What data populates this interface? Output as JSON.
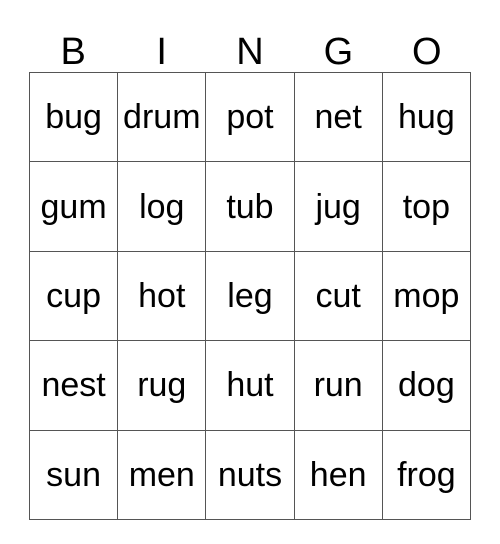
{
  "card": {
    "title": "BINGO",
    "header_letters": [
      "B",
      "I",
      "N",
      "G",
      "O"
    ],
    "colors": {
      "background": "#ffffff",
      "text": "#000000",
      "grid_line": "#555555"
    },
    "rows": [
      [
        "bug",
        "drum",
        "pot",
        "net",
        "hug"
      ],
      [
        "gum",
        "log",
        "tub",
        "jug",
        "top"
      ],
      [
        "cup",
        "hot",
        "leg",
        "cut",
        "mop"
      ],
      [
        "nest",
        "rug",
        "hut",
        "run",
        "dog"
      ],
      [
        "sun",
        "men",
        "nuts",
        "hen",
        "frog"
      ]
    ]
  }
}
